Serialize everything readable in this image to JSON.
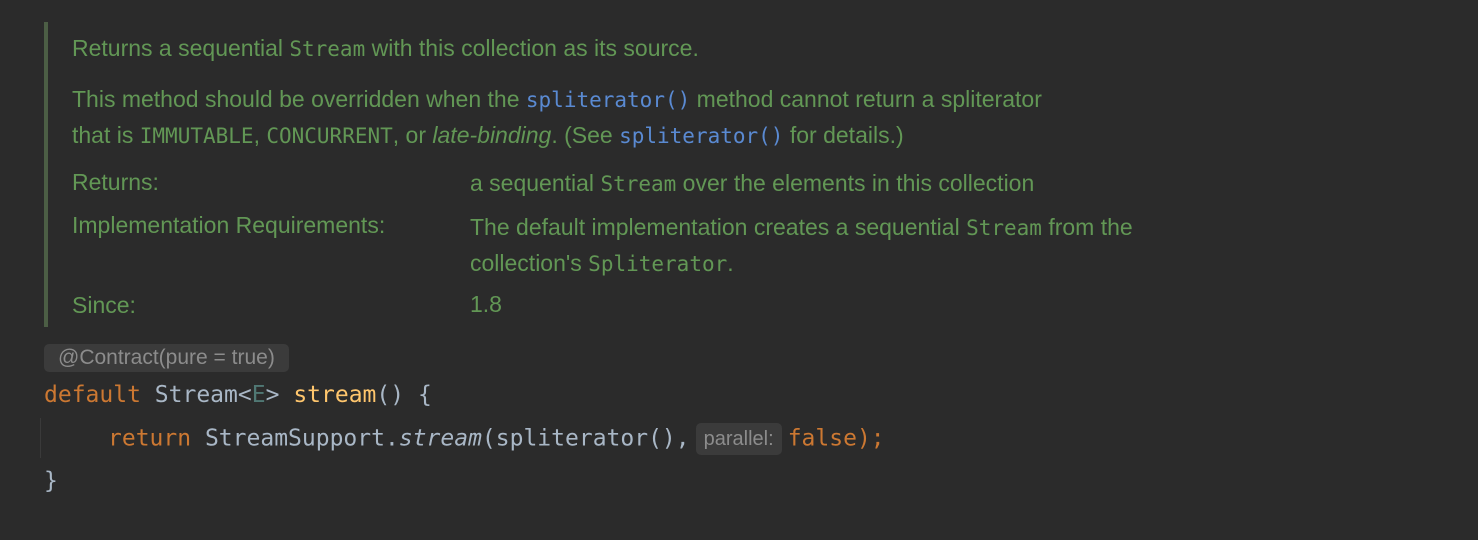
{
  "javadoc": {
    "summary": {
      "pre": "Returns a sequential ",
      "code": "Stream",
      "post": " with this collection as its source."
    },
    "para": {
      "l1_pre": "This method should be overridden when the ",
      "l1_link": "spliterator()",
      "l1_post": " method cannot return a spliterator",
      "l2_pre": "that is ",
      "l2_code1": "IMMUTABLE",
      "l2_sep1": ", ",
      "l2_code2": "CONCURRENT",
      "l2_sep2": ", or ",
      "l2_italic": "late-binding",
      "l2_mid": ". (See ",
      "l2_link": "spliterator()",
      "l2_post": " for details.)"
    },
    "returns": {
      "label": "Returns:",
      "pre": "a sequential ",
      "code": "Stream",
      "post": " over the elements in this collection"
    },
    "impl": {
      "label": "Implementation Requirements:",
      "l1_pre": "The default implementation creates a sequential ",
      "l1_code": "Stream",
      "l1_post": " from the",
      "l2_pre": "collection's ",
      "l2_code": "Spliterator",
      "l2_post": "."
    },
    "since": {
      "label": "Since:",
      "value": "1.8"
    }
  },
  "annotation_hint": "@Contract(pure = true)",
  "code": {
    "sig_default": "default",
    "sig_type_pre": "Stream<",
    "sig_type_param": "E",
    "sig_type_post": ">",
    "sig_name": "stream",
    "sig_rest": "() {",
    "body_return": "return",
    "body_class": "StreamSupport.",
    "body_method": "stream",
    "body_args": "(spliterator(),",
    "param_hint": "parallel:",
    "body_false": "false",
    "body_end": ");",
    "close_brace": "}"
  },
  "colors": {
    "background": "#2b2b2b",
    "doc_text": "#629755",
    "doc_link": "#5a8ad2",
    "keyword": "#cc7832",
    "function": "#ffc66d",
    "type_param": "#507874",
    "plain": "#a9b7c6",
    "hint_bg": "#3b3b3b",
    "hint_text": "#8c8c8c"
  }
}
